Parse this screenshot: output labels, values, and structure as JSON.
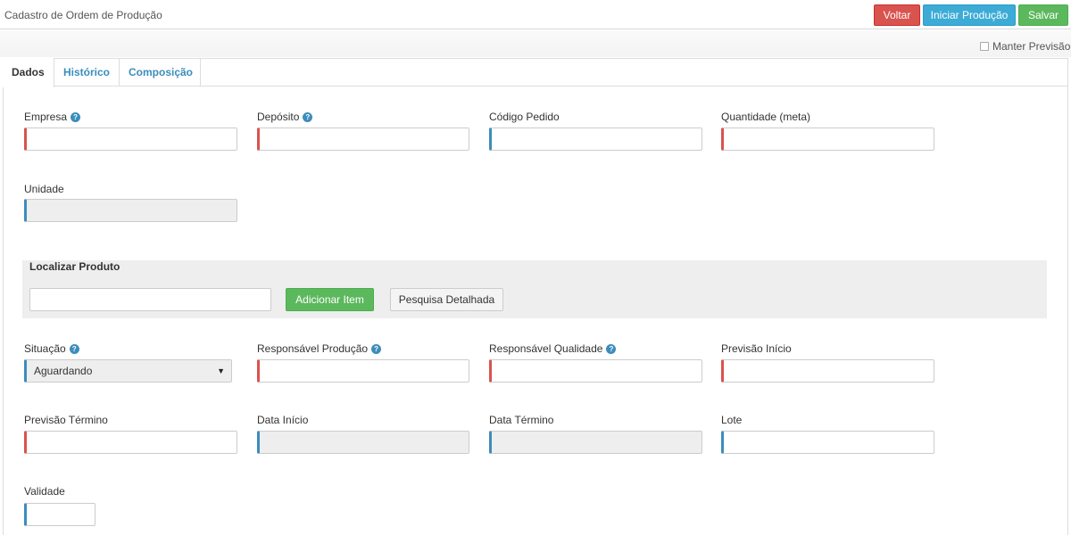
{
  "header": {
    "title": "Cadastro de Ordem de Produção",
    "btn_voltar": "Voltar",
    "btn_iniciar": "Iniciar Produção",
    "btn_salvar": "Salvar",
    "manter_previsao": "Manter Previsão"
  },
  "tabs": [
    "Dados",
    "Histórico",
    "Composição"
  ],
  "fields": {
    "empresa": "Empresa",
    "deposito": "Depósito",
    "codigo_pedido": "Código Pedido",
    "quantidade": "Quantidade (meta)",
    "unidade": "Unidade",
    "situacao": "Situação",
    "situacao_value": "Aguardando",
    "resp_producao": "Responsável Produção",
    "resp_qualidade": "Responsável Qualidade",
    "previsao_inicio": "Previsão Início",
    "previsao_termino": "Previsão Término",
    "data_inicio": "Data Início",
    "data_termino": "Data Término",
    "lote": "Lote",
    "validade": "Validade"
  },
  "produto": {
    "title": "Localizar Produto",
    "btn_add": "Adicionar Item",
    "btn_pesquisa": "Pesquisa Detalhada"
  },
  "colors": {
    "required": "#d9534f",
    "optional": "#3c8dbc",
    "success": "#5cb85c",
    "info": "#3cabd6"
  }
}
